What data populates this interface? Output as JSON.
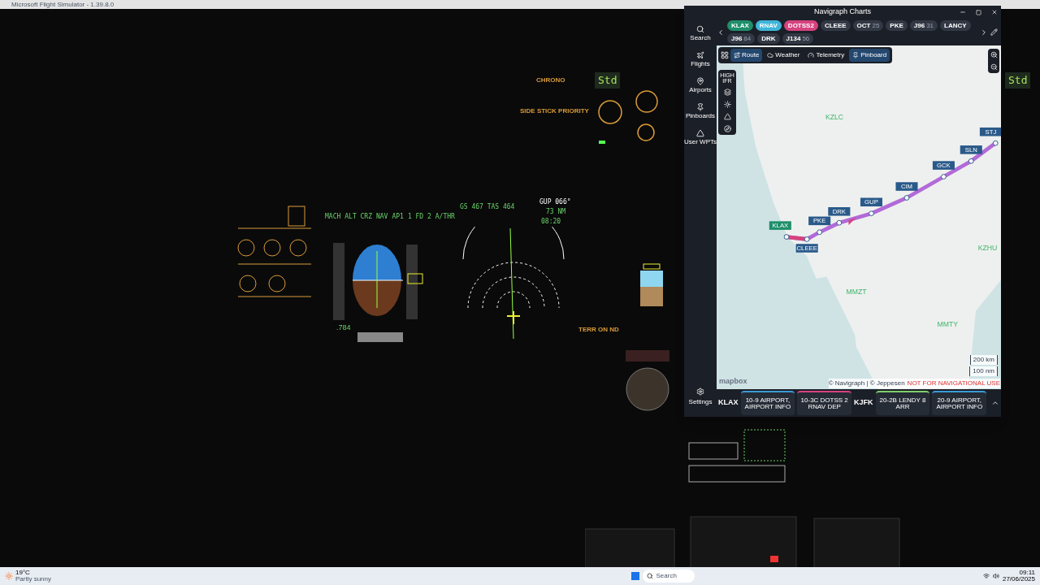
{
  "app_title": "Microsoft Flight Simulator - 1.39.8.0",
  "cockpit": {
    "labels": [
      {
        "kind": "amber",
        "text": "CHRONO"
      },
      {
        "kind": "amber",
        "text": "SIDE STICK PRIORITY"
      },
      {
        "kind": "amber",
        "text": "TERR ON ND"
      }
    ],
    "efis_baro": [
      "Std",
      "Std"
    ],
    "fma": [
      "MACH",
      "ALT CRZ",
      "NAV",
      "AP1",
      "1 FD 2",
      "A/THR"
    ],
    "mach": ".784",
    "nd_info": [
      "GS 467 TAS 464",
      "GUP 066°",
      "73 NM",
      "08:20"
    ]
  },
  "charts": {
    "title": "Navigraph Charts",
    "route": [
      {
        "label": "KLAX",
        "color": "#1f8f6a"
      },
      {
        "label": "RNAV",
        "color": "#3fb5d8"
      },
      {
        "label": "DOTSS2",
        "color": "#d6427e"
      },
      {
        "label": "CLEEE"
      },
      {
        "label": "OCT",
        "sub": "25"
      },
      {
        "label": "PKE"
      },
      {
        "label": "J96",
        "sub": "31"
      },
      {
        "label": "LANCY"
      },
      {
        "label": "J96",
        "sub": "84"
      },
      {
        "label": "DRK"
      },
      {
        "label": "J134",
        "sub": "56"
      }
    ],
    "sidebar": [
      {
        "kind": "search",
        "label": "Search"
      },
      {
        "kind": "flights",
        "label": "Flights"
      },
      {
        "kind": "airports",
        "label": "Airports"
      },
      {
        "kind": "pinboards",
        "label": "Pinboards"
      },
      {
        "kind": "waypoint",
        "label": "User WPTs"
      }
    ],
    "settings": "Settings",
    "toolbar": [
      {
        "label": "Route",
        "selected": true
      },
      {
        "label": "Weather",
        "selected": false
      },
      {
        "label": "Telemetry",
        "selected": false
      },
      {
        "label": "Pinboard",
        "selected": true
      }
    ],
    "layer_label": "HIGH IFR",
    "waypoints": [
      {
        "label": "KLAX",
        "kind": "airport"
      },
      {
        "label": "CLEEE",
        "kind": "fix"
      },
      {
        "label": "PKE",
        "kind": "fix"
      },
      {
        "label": "DRK",
        "kind": "fix"
      },
      {
        "label": "GUP",
        "kind": "fix"
      },
      {
        "label": "CIM",
        "kind": "fix"
      },
      {
        "label": "GCK",
        "kind": "fix"
      },
      {
        "label": "SLN",
        "kind": "fix"
      },
      {
        "label": "STJ",
        "kind": "fix"
      }
    ],
    "regions": [
      "KZLC",
      "MMZT",
      "MMTY",
      "KZHU"
    ],
    "scale": [
      "200 km",
      "100 nm"
    ],
    "map_brand": "mapbox",
    "attribution": "© Navigraph | © Jeppesen",
    "warning": "NOT FOR NAVIGATIONAL USE",
    "bottom": [
      {
        "kind": "airport",
        "label": "KLAX"
      },
      {
        "kind": "chart",
        "label": "10-9 AIRPORT, AIRPORT INFO",
        "color": "#3b9bd6"
      },
      {
        "kind": "chart",
        "label": "10-3C DOTSS 2 RNAV DEP",
        "color": "#d6427e"
      },
      {
        "kind": "airport",
        "label": "KJFK"
      },
      {
        "kind": "chart",
        "label": "20-2B LENDY 8 ARR",
        "color": "#7fcf6a"
      },
      {
        "kind": "chart",
        "label": "20-9 AIRPORT, AIRPORT INFO",
        "color": "#3b9bd6"
      }
    ]
  },
  "taskbar": {
    "temp": "19°C",
    "weather": "Partly sunny",
    "search": "Search",
    "time": "09:11",
    "date": "27/06/2025"
  }
}
